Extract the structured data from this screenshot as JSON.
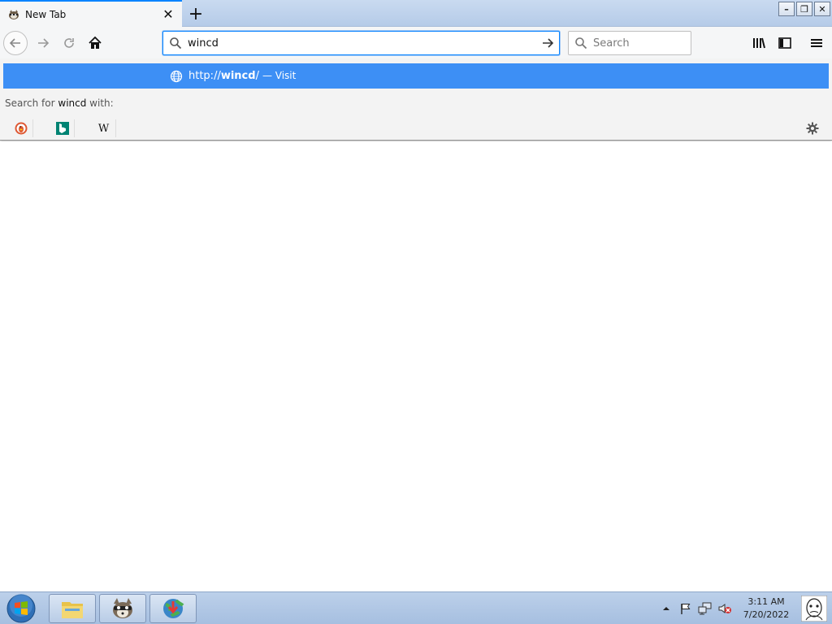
{
  "window": {
    "tab_title": "New Tab",
    "tab_close_label": "✕",
    "new_tab_label": "+",
    "minimize_label": "–",
    "restore_label": "❐",
    "close_label": "✕"
  },
  "toolbar": {
    "back_icon": "back-arrow-icon",
    "forward_icon": "forward-arrow-icon",
    "reload_icon": "reload-icon",
    "home_icon": "home-icon",
    "url_value": "wincd",
    "search_placeholder": "Search",
    "library_icon": "library-icon",
    "sidebar_icon": "sidebar-icon",
    "menu_icon": "hamburger-menu-icon"
  },
  "autocomplete": {
    "result_scheme": "http://",
    "result_host": "wincd",
    "result_trailing": "/",
    "result_action": "— Visit",
    "search_for_prefix": "Search for",
    "search_for_term": "wincd",
    "search_for_suffix": "with:",
    "engines": [
      "DuckDuckGo",
      "Bing",
      "Wikipedia"
    ],
    "highlight_color": "#3d8ff5"
  },
  "taskbar": {
    "start_icon": "windows-start-orb-icon",
    "pinned": [
      "file-explorer-icon",
      "raccoon-app-icon",
      "globe-download-app-icon"
    ],
    "clock_time": "3:11 AM",
    "clock_date": "7/20/2022",
    "tray_icons": [
      "show-hidden-icons-chevron",
      "action-center-flag-icon",
      "network-icon",
      "volume-muted-icon"
    ]
  },
  "colors": {
    "accent": "#0a84ff",
    "taskbar": "#b5cbe8"
  }
}
